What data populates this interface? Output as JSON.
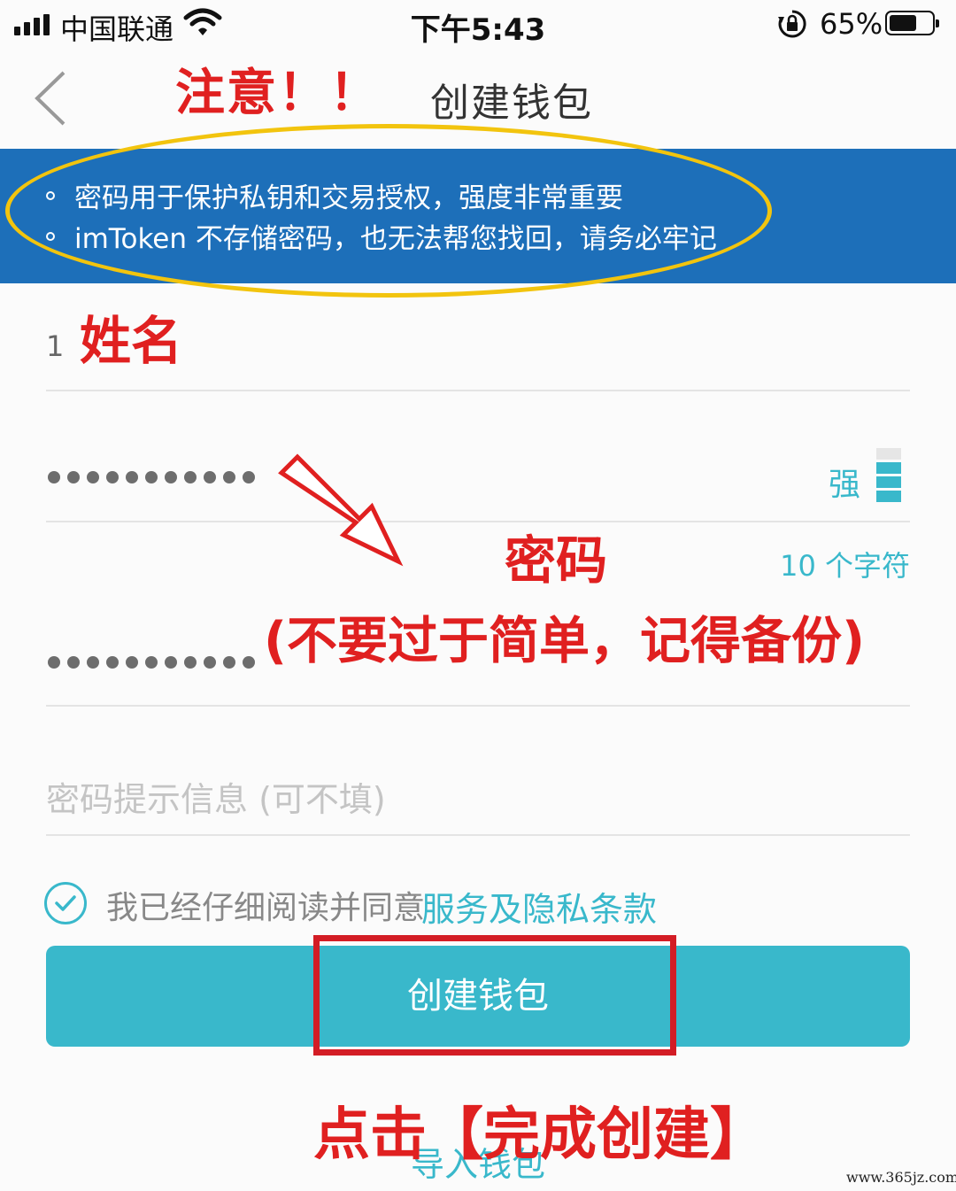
{
  "status_bar": {
    "carrier": "中国联通",
    "time": "下午5:43",
    "battery_percent": "65%",
    "battery_level": 0.65
  },
  "nav": {
    "back_icon": "chevron-left-icon",
    "title": "创建钱包"
  },
  "banner": {
    "tips": [
      "密码用于保护私钥和交易授权，强度非常重要",
      "imToken 不存储密码，也无法帮您找回，请务必牢记"
    ]
  },
  "form": {
    "name_value": "1",
    "password_value": "●●●●●●●●●●●",
    "password_strength_label": "强",
    "password_strength_level": 3,
    "password_strength_max": 4,
    "password_char_count": "10 个字符",
    "confirm_password_value": "●●●●●●●●●●●",
    "hint_placeholder": "密码提示信息 (可不填)"
  },
  "agreement": {
    "checked": true,
    "text": "我已经仔细阅读并同意",
    "link": "服务及隐私条款"
  },
  "buttons": {
    "create": "创建钱包",
    "import": "导入钱包"
  },
  "annotations": {
    "attention": "注意！！",
    "name": "姓名",
    "password": "密码",
    "password_note": "(不要过于简单，记得备份)",
    "click": "点击【完成创建】"
  },
  "watermark": "www.365jz.com",
  "colors": {
    "banner": "#1d6fb9",
    "accent": "#39b8cb",
    "annotation_red": "#e02020",
    "highlight_yellow": "#f2c40e"
  }
}
